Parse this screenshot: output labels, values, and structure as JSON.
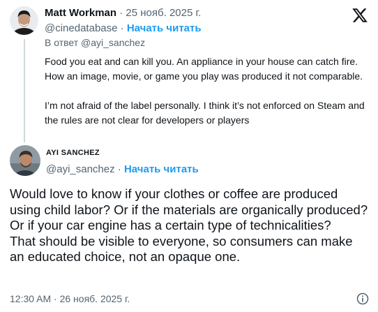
{
  "parent_tweet": {
    "display_name": "Matt Workman",
    "separator": "·",
    "date": "25 нояб. 2025 г.",
    "handle": "@cinedatabase",
    "handle_separator": "·",
    "follow_label": "Начать читать",
    "reply_prefix": "В ответ",
    "reply_mention": "@ayi_sanchez",
    "text": "Food you eat and can kill you.  An appliance in your house can catch fire.  How an image, movie, or game you play was produced it not comparable.\n\nI’m not afraid of the label personally.  I think it’s not enforced on Steam and the rules are not clear for developers or players"
  },
  "main_tweet": {
    "display_name": "AYI SANCHEZ",
    "handle": "@ayi_sanchez",
    "handle_separator": "·",
    "follow_label": "Начать читать",
    "text_line1": "Would love to know if your clothes or coffee are produced using child labor? Or if the materials are organically produced? Or if your car engine has a certain type of technicalities?",
    "text_line2": "That should be visible to everyone, so consumers can make an educated choice, not an opaque one.",
    "timestamp": "12:30 AM · 26 нояб. 2025 г."
  },
  "icons": {
    "brand": "x-logo-icon",
    "info": "info-icon"
  },
  "colors": {
    "accent": "#1d9bf0",
    "secondary_text": "#536471",
    "primary_text": "#0f1419",
    "thread_line": "#cfd9de"
  }
}
